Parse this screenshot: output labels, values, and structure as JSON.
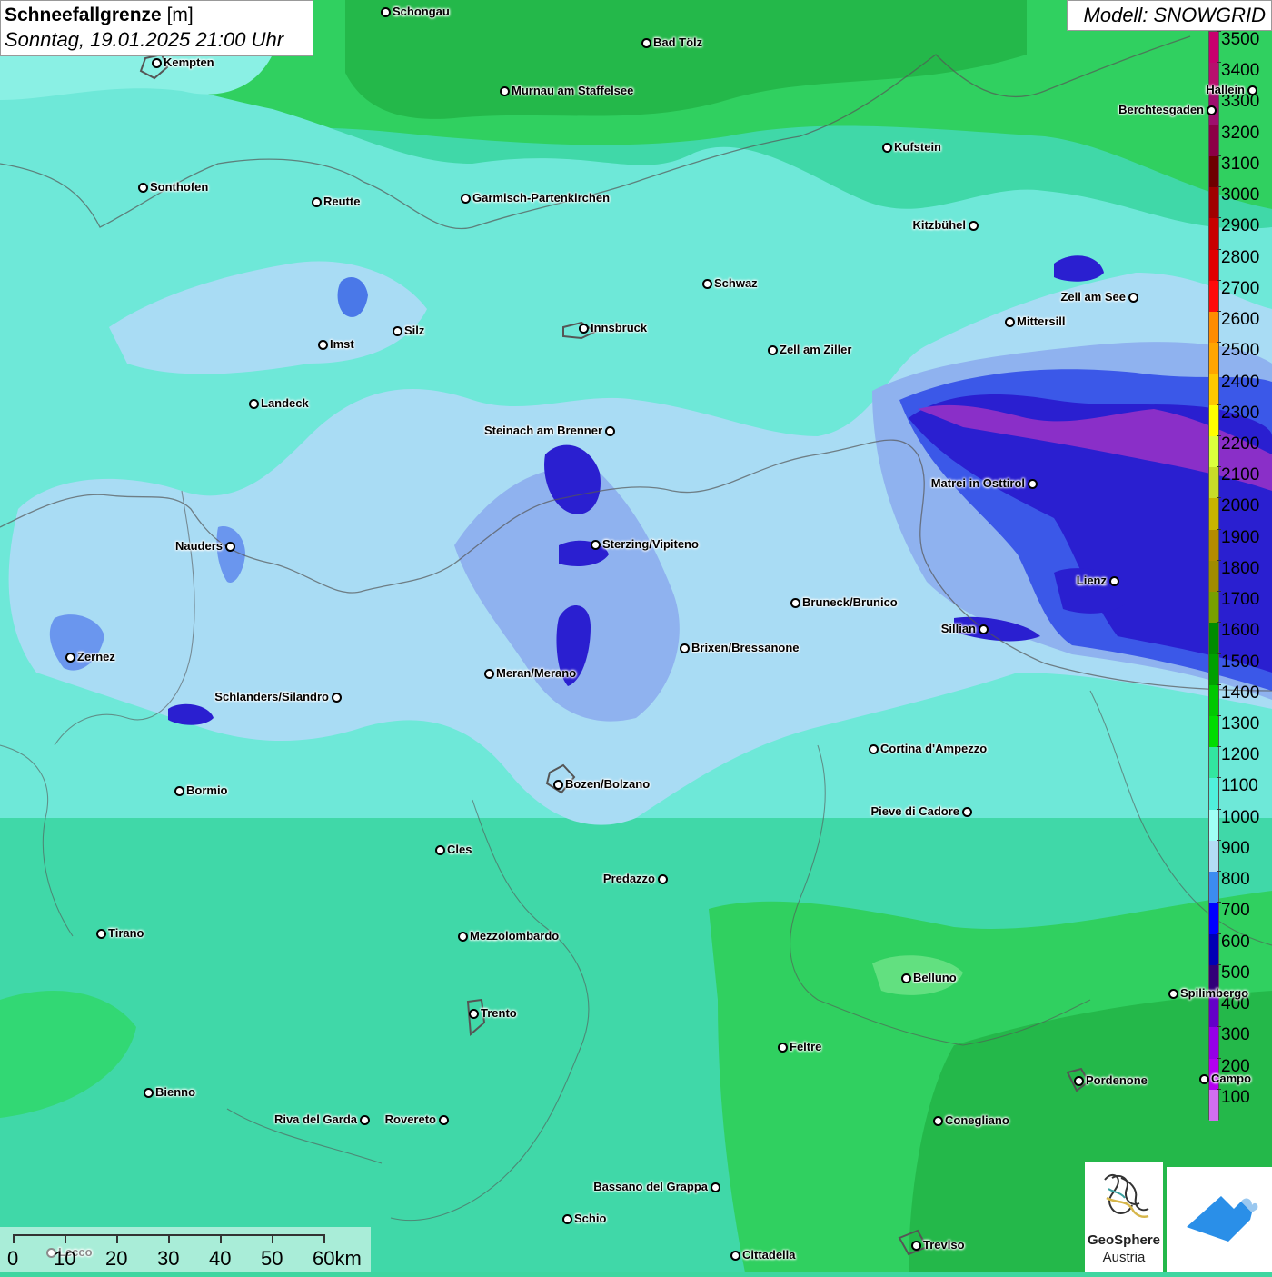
{
  "title": {
    "name": "Schneefallgrenze",
    "unit": "[m]",
    "datetime": "Sonntag, 19.01.2025 21:00 Uhr"
  },
  "model": "Modell: SNOWGRID",
  "colors": {
    "low_band": "#b64dd6",
    "mid_blue": "#3a4fe0",
    "light_blue": "#a8d8f2",
    "cyan": "#7ff0e8",
    "green": "#2fd25a",
    "dark_green": "#1f9e3a"
  },
  "legend": {
    "labels": [
      "3500",
      "3400",
      "3300",
      "3200",
      "3100",
      "3000",
      "2900",
      "2800",
      "2700",
      "2600",
      "2500",
      "2400",
      "2300",
      "2200",
      "2100",
      "2000",
      "1900",
      "1800",
      "1700",
      "1600",
      "1500",
      "1400",
      "1300",
      "1200",
      "1100",
      "1000",
      "900",
      "800",
      "700",
      "600",
      "500",
      "400",
      "300",
      "200",
      "100"
    ],
    "colors": [
      "#c8006e",
      "#b80f6e",
      "#9e0f6e",
      "#8c0046",
      "#6e0000",
      "#a00000",
      "#c80000",
      "#e10000",
      "#ff0a0a",
      "#ff8c00",
      "#ffa500",
      "#ffc800",
      "#ffff00",
      "#dcff3c",
      "#c8dc28",
      "#c8b400",
      "#b48c00",
      "#a08c00",
      "#78a000",
      "#008c00",
      "#00a000",
      "#00c800",
      "#00dc00",
      "#32e6a0",
      "#50f0dc",
      "#a0fff5",
      "#b4dcf5",
      "#3c8cf0",
      "#0000ff",
      "#0000b4",
      "#320078",
      "#6400c8",
      "#9600e6",
      "#b400f0",
      "#d26ef0"
    ]
  },
  "cities": [
    {
      "name": "Schongau"
    },
    {
      "name": "Kempten"
    },
    {
      "name": "Bad Tölz"
    },
    {
      "name": "Murnau am Staffelsee"
    },
    {
      "name": "Hallein"
    },
    {
      "name": "Berchtesgaden"
    },
    {
      "name": "Kufstein"
    },
    {
      "name": "Sonthofen"
    },
    {
      "name": "Reutte"
    },
    {
      "name": "Garmisch-Partenkirchen"
    },
    {
      "name": "Kitzbühel"
    },
    {
      "name": "Schwaz"
    },
    {
      "name": "Zell am See"
    },
    {
      "name": "Mittersill"
    },
    {
      "name": "Innsbruck"
    },
    {
      "name": "Imst"
    },
    {
      "name": "Silz"
    },
    {
      "name": "Zell am Ziller"
    },
    {
      "name": "Landeck"
    },
    {
      "name": "Steinach am Brenner"
    },
    {
      "name": "Matrei in Osttirol"
    },
    {
      "name": "Nauders"
    },
    {
      "name": "Sterzing/Vipiteno"
    },
    {
      "name": "Lienz"
    },
    {
      "name": "Bruneck/Brunico"
    },
    {
      "name": "Sillian"
    },
    {
      "name": "Zernez"
    },
    {
      "name": "Brixen/Bressanone"
    },
    {
      "name": "Meran/Merano"
    },
    {
      "name": "Schlanders/Silandro"
    },
    {
      "name": "Cortina d'Ampezzo"
    },
    {
      "name": "Bozen/Bolzano"
    },
    {
      "name": "Bormio"
    },
    {
      "name": "Pieve di Cadore"
    },
    {
      "name": "Cles"
    },
    {
      "name": "Predazzo"
    },
    {
      "name": "Tirano"
    },
    {
      "name": "Mezzolombardo"
    },
    {
      "name": "Belluno"
    },
    {
      "name": "Spilimbergo"
    },
    {
      "name": "Trento"
    },
    {
      "name": "Feltre"
    },
    {
      "name": "Pordenone"
    },
    {
      "name": "Campo"
    },
    {
      "name": "Bienno"
    },
    {
      "name": "Riva del Garda"
    },
    {
      "name": "Rovereto"
    },
    {
      "name": "Conegliano"
    },
    {
      "name": "Bassano del Grappa"
    },
    {
      "name": "Schio"
    },
    {
      "name": "Treviso"
    },
    {
      "name": "Cittadella"
    },
    {
      "name": "Lecco"
    }
  ],
  "scale": {
    "labels": [
      "0",
      "10",
      "20",
      "30",
      "40",
      "50",
      "60km"
    ]
  },
  "logos": {
    "geosphere_line1": "GeoSphere",
    "geosphere_line2": "Austria"
  }
}
